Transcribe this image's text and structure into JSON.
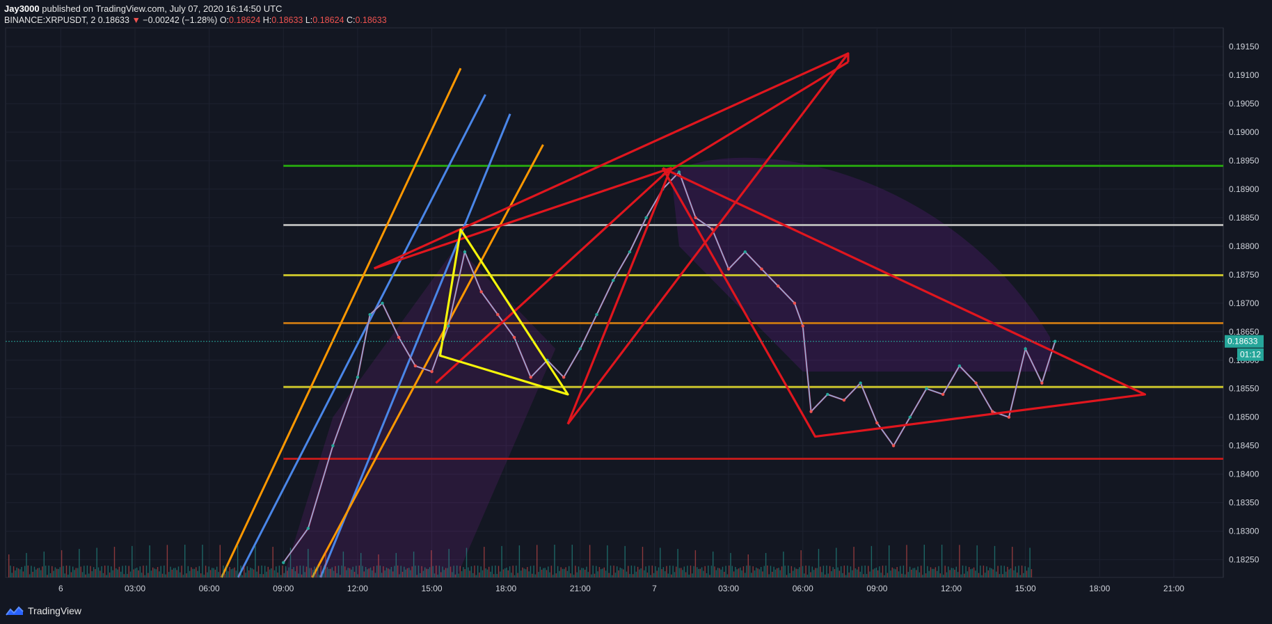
{
  "header": {
    "author": "Jay3000",
    "published_text": "published on TradingView.com, July 07, 2020 16:14:50 UTC",
    "symbol": "BINANCE:XRPUSDT, 2",
    "last": "0.18633",
    "change_arrow": "▼",
    "change": "−0.00242 (−1.28%)",
    "o_label": "O:",
    "o_value": "0.18624",
    "h_label": "H:",
    "h_value": "0.18633",
    "l_label": "L:",
    "l_value": "0.18624",
    "c_label": "C:",
    "c_value": "0.18633"
  },
  "footer": {
    "brand": "TradingView",
    "logo_icon": "tradingview-logo-icon"
  },
  "price_badge": {
    "price": "0.18633",
    "countdown": "01:12",
    "color": "#26a69a"
  },
  "colors": {
    "background": "#131722",
    "grid": "#1e2230",
    "up": "#26a69a",
    "down": "#ef5350",
    "red_line": "#e0161e",
    "yellow_line": "#f5f50a",
    "orange_line": "#ff9800",
    "blue_line": "#4a86e8",
    "green_level": "#26a30f",
    "gray_level": "#b4b4b4",
    "olive_level": "#c9c32c",
    "brown_level": "#c07314",
    "darkred_level": "#c01b1b"
  },
  "chart_data": {
    "type": "line",
    "title": "BINANCE:XRPUSDT, 2",
    "y_axis": {
      "ticks": [
        "0.19150",
        "0.19100",
        "0.19050",
        "0.19000",
        "0.18950",
        "0.18900",
        "0.18850",
        "0.18800",
        "0.18750",
        "0.18700",
        "0.18650",
        "0.18600",
        "0.18550",
        "0.18500",
        "0.18450",
        "0.18400",
        "0.18350",
        "0.18300",
        "0.18250"
      ],
      "ylim": [
        0.18219,
        0.19183
      ]
    },
    "x_axis": {
      "ticks": [
        "6",
        "03:00",
        "06:00",
        "09:00",
        "12:00",
        "15:00",
        "18:00",
        "21:00",
        "7",
        "03:00",
        "06:00",
        "09:00",
        "12:00",
        "15:00",
        "18:00",
        "21:00"
      ],
      "range": [
        "2020-07-05 21:46",
        "2020-07-07 23:00"
      ]
    },
    "grid": true,
    "series": [
      {
        "style": "candles-close",
        "x": [
          "2020-07-06 09:00",
          "2020-07-06 10:00",
          "2020-07-06 11:00",
          "2020-07-06 12:00",
          "2020-07-06 12:30",
          "2020-07-06 13:00",
          "2020-07-06 13:40",
          "2020-07-06 14:20",
          "2020-07-06 15:00",
          "2020-07-06 15:40",
          "2020-07-06 16:20",
          "2020-07-06 17:00",
          "2020-07-06 17:40",
          "2020-07-06 18:20",
          "2020-07-06 19:00",
          "2020-07-06 19:40",
          "2020-07-06 20:20",
          "2020-07-06 21:00",
          "2020-07-06 21:40",
          "2020-07-06 22:20",
          "2020-07-06 23:00",
          "2020-07-06 23:40",
          "2020-07-07 00:20",
          "2020-07-07 01:00",
          "2020-07-07 01:40",
          "2020-07-07 02:20",
          "2020-07-07 03:00",
          "2020-07-07 03:40",
          "2020-07-07 04:20",
          "2020-07-07 05:00",
          "2020-07-07 05:40",
          "2020-07-07 06:00",
          "2020-07-07 06:20",
          "2020-07-07 07:00",
          "2020-07-07 07:40",
          "2020-07-07 08:20",
          "2020-07-07 09:00",
          "2020-07-07 09:40",
          "2020-07-07 10:20",
          "2020-07-07 11:00",
          "2020-07-07 11:40",
          "2020-07-07 12:20",
          "2020-07-07 13:00",
          "2020-07-07 13:40",
          "2020-07-07 14:20",
          "2020-07-07 15:00",
          "2020-07-07 15:40",
          "2020-07-07 16:12"
        ],
        "values": [
          0.18245,
          0.18305,
          0.1845,
          0.1857,
          0.1868,
          0.187,
          0.1864,
          0.1859,
          0.1858,
          0.1866,
          0.1879,
          0.1872,
          0.1868,
          0.1864,
          0.1857,
          0.186,
          0.1857,
          0.1862,
          0.1868,
          0.1874,
          0.1879,
          0.1885,
          0.189,
          0.1893,
          0.1885,
          0.1883,
          0.1876,
          0.1879,
          0.1876,
          0.1873,
          0.187,
          0.1866,
          0.1851,
          0.1854,
          0.1853,
          0.1856,
          0.1849,
          0.1845,
          0.185,
          0.1855,
          0.1854,
          0.1859,
          0.1856,
          0.1851,
          0.185,
          0.1862,
          0.1856,
          0.18633
        ]
      }
    ],
    "horizontal_levels": [
      0.18941,
      0.18837,
      0.18749,
      0.18665,
      0.18553,
      0.18427
    ],
    "trend_lines": [
      {
        "from": [
          "2020-07-06 06:30",
          0.18219
        ],
        "to": [
          "2020-07-06 16:10",
          0.19112
        ],
        "color": "orange"
      },
      {
        "from": [
          "2020-07-06 07:10",
          0.18219
        ],
        "to": [
          "2020-07-06 17:10",
          0.19066
        ],
        "color": "blue"
      },
      {
        "from": [
          "2020-07-06 10:30",
          0.18219
        ],
        "to": [
          "2020-07-06 18:10",
          0.19032
        ],
        "color": "blue"
      },
      {
        "from": [
          "2020-07-06 10:10",
          0.18219
        ],
        "to": [
          "2020-07-06 19:30",
          0.18978
        ],
        "color": "orange"
      }
    ],
    "red_patterns": [
      [
        [
          "2020-07-06 12:40",
          0.18761
        ],
        [
          "2020-07-07 00:40",
          0.18937
        ],
        [
          "2020-07-06 15:10",
          0.1856
        ]
      ],
      [
        [
          "2020-07-06 20:30",
          0.18488
        ],
        [
          "2020-07-07 07:50",
          0.19138
        ],
        [
          "2020-07-07 07:50",
          0.19123
        ]
      ],
      [
        [
          "2020-07-06 20:30",
          0.18488
        ],
        [
          "2020-07-07 00:40",
          0.18937
        ]
      ],
      [
        [
          "2020-07-06 12:40",
          0.18761
        ],
        [
          "2020-07-07 07:50",
          0.19138
        ]
      ],
      [
        [
          "2020-07-07 00:20",
          0.18925
        ],
        [
          "2020-07-07 07:50",
          0.19123
        ]
      ],
      [
        [
          "2020-07-07 00:20",
          0.18937
        ],
        [
          "2020-07-07 05:90",
          0.18466
        ],
        [
          "2020-07-07 19:50",
          0.1854
        ],
        [
          "2020-07-07 00:20",
          0.18937
        ]
      ]
    ],
    "yellow_pattern": [
      [
        "2020-07-06 15:20",
        0.18608
      ],
      [
        "2020-07-06 16:10",
        0.18829
      ],
      [
        "2020-07-06 20:30",
        0.1854
      ]
    ]
  }
}
